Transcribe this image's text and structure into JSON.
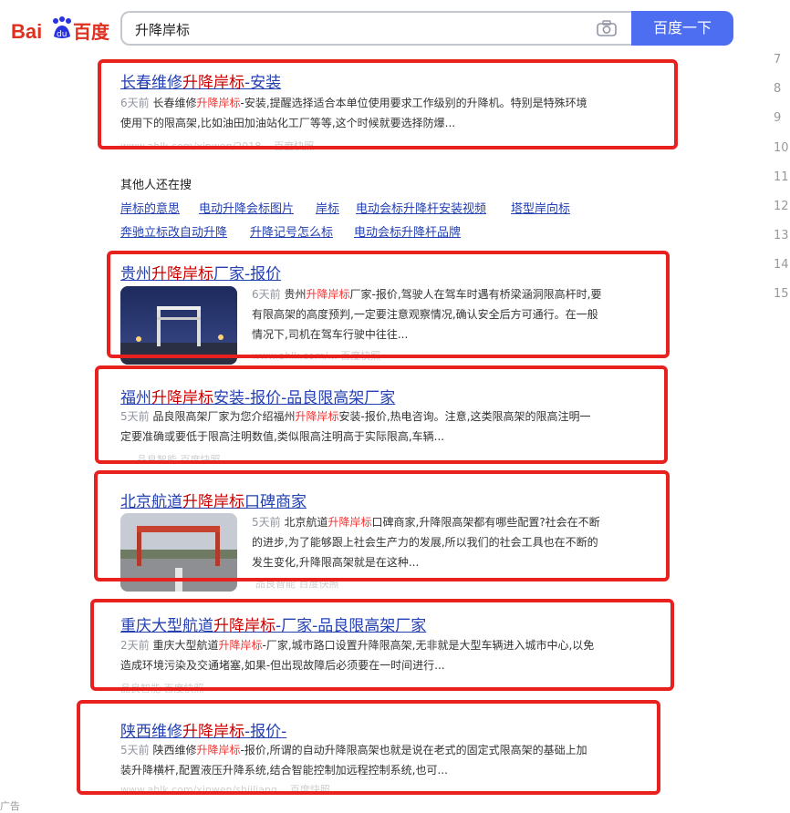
{
  "search": {
    "query": "升降岸标",
    "button_label": "百度一下",
    "logo_text": "Bai百度"
  },
  "results": [
    {
      "title_pre": "长春维修",
      "title_hl": "升降岸标",
      "title_post": "-安装",
      "date": "6天前",
      "abs1_pre": "长春维修",
      "abs1_hl": "升降岸标",
      "abs1_post": "-安装,提醒选择适合本单位使用要求工作级别的升降机。特别是特殊环境",
      "abs2": "使用下的限高架,比如油田加油站化工厂等等,这个时候就要选择防爆...",
      "footer": "www.ahlk.com/xinwen/2018...   百度快照"
    },
    {
      "title_pre": "贵州",
      "title_hl": "升降岸标",
      "title_post": "厂家-报价",
      "date": "6天前",
      "abs1_pre": "贵州",
      "abs1_hl": "升降岸标",
      "abs1_post": "厂家-报价,驾驶人在驾车时遇有桥梁涵洞限高杆时,要",
      "abs2": "有限高架的高度预判,一定要注意观察情况,确认安全后方可通行。在一般",
      "abs3": "情况下,司机在驾车行驶中往往...",
      "footer": "www.ahlk.com/...   百度快照"
    },
    {
      "title_pre": "福州",
      "title_hl": "升降岸标",
      "title_post": "安装-报价-品良限高架厂家",
      "date": "5天前",
      "abs1_pre": "品良限高架厂家为您介绍福州",
      "abs1_hl": "升降岸标",
      "abs1_post": "安装-报价,热电咨询。注意,这类限高架的限高注明一",
      "abs2": "定要准确或要低于限高注明数值,类似限高注明高于实际限高,车辆...",
      "footer": "品良智能   百度快照"
    },
    {
      "title_pre": "北京航道",
      "title_hl": "升降岸标",
      "title_post": "口碑商家",
      "date": "5天前",
      "abs1_pre": "北京航道",
      "abs1_hl": "升降岸标",
      "abs1_post": "口碑商家,升降限高架都有哪些配置?社会在不断",
      "abs2": "的进步,为了能够跟上社会生产力的发展,所以我们的社会工具也在不断的",
      "abs3": "发生变化,升降限高架就是在这种...",
      "footer": "品良智能   百度快照"
    },
    {
      "title_pre": "重庆大型航道",
      "title_hl": "升降岸标",
      "title_post": "-厂家-品良限高架厂家",
      "date": "2天前",
      "abs1_pre": "重庆大型航道",
      "abs1_hl": "升降岸标",
      "abs1_post": "-厂家,城市路口设置升降限高架,无非就是大型车辆进入城市中心,以免",
      "abs2": "造成环境污染及交通堵塞,如果-但出现故障后必须要在一时间进行...",
      "footer": "品良智能   百度快照"
    },
    {
      "title_pre": "陕西维修",
      "title_hl": "升降岸标",
      "title_post": "-报价-",
      "date": "5天前",
      "abs1_pre": "陕西维修",
      "abs1_hl": "升降岸标",
      "abs1_post": "-报价,所谓的自动升降限高架也就是说在老式的固定式限高架的基础上加",
      "abs2": "装升降横杆,配置液压升降系统,结合智能控制加远程控制系统,也可...",
      "footer": "www.ahlk.com/xinwen/shjiliang...   百度快照"
    }
  ],
  "related": {
    "heading": "其他人还在搜",
    "row1": [
      "岸标的意思",
      "电动升降会标图片",
      "岸标",
      "电动会标升降杆安装视频",
      "塔型岸向标"
    ],
    "row2": [
      "奔驰立标改自动升降",
      "升降记号怎么标",
      "电动会标升降杆品牌"
    ]
  },
  "pager": [
    "7",
    "8",
    "9",
    "10",
    "11",
    "12",
    "13",
    "14",
    "15"
  ],
  "bottom_text": "广告",
  "colors": {
    "highlight_box": "#e8201e",
    "link": "#2440b3",
    "accent": "#4e6ef2",
    "keyword": "#f73131"
  }
}
